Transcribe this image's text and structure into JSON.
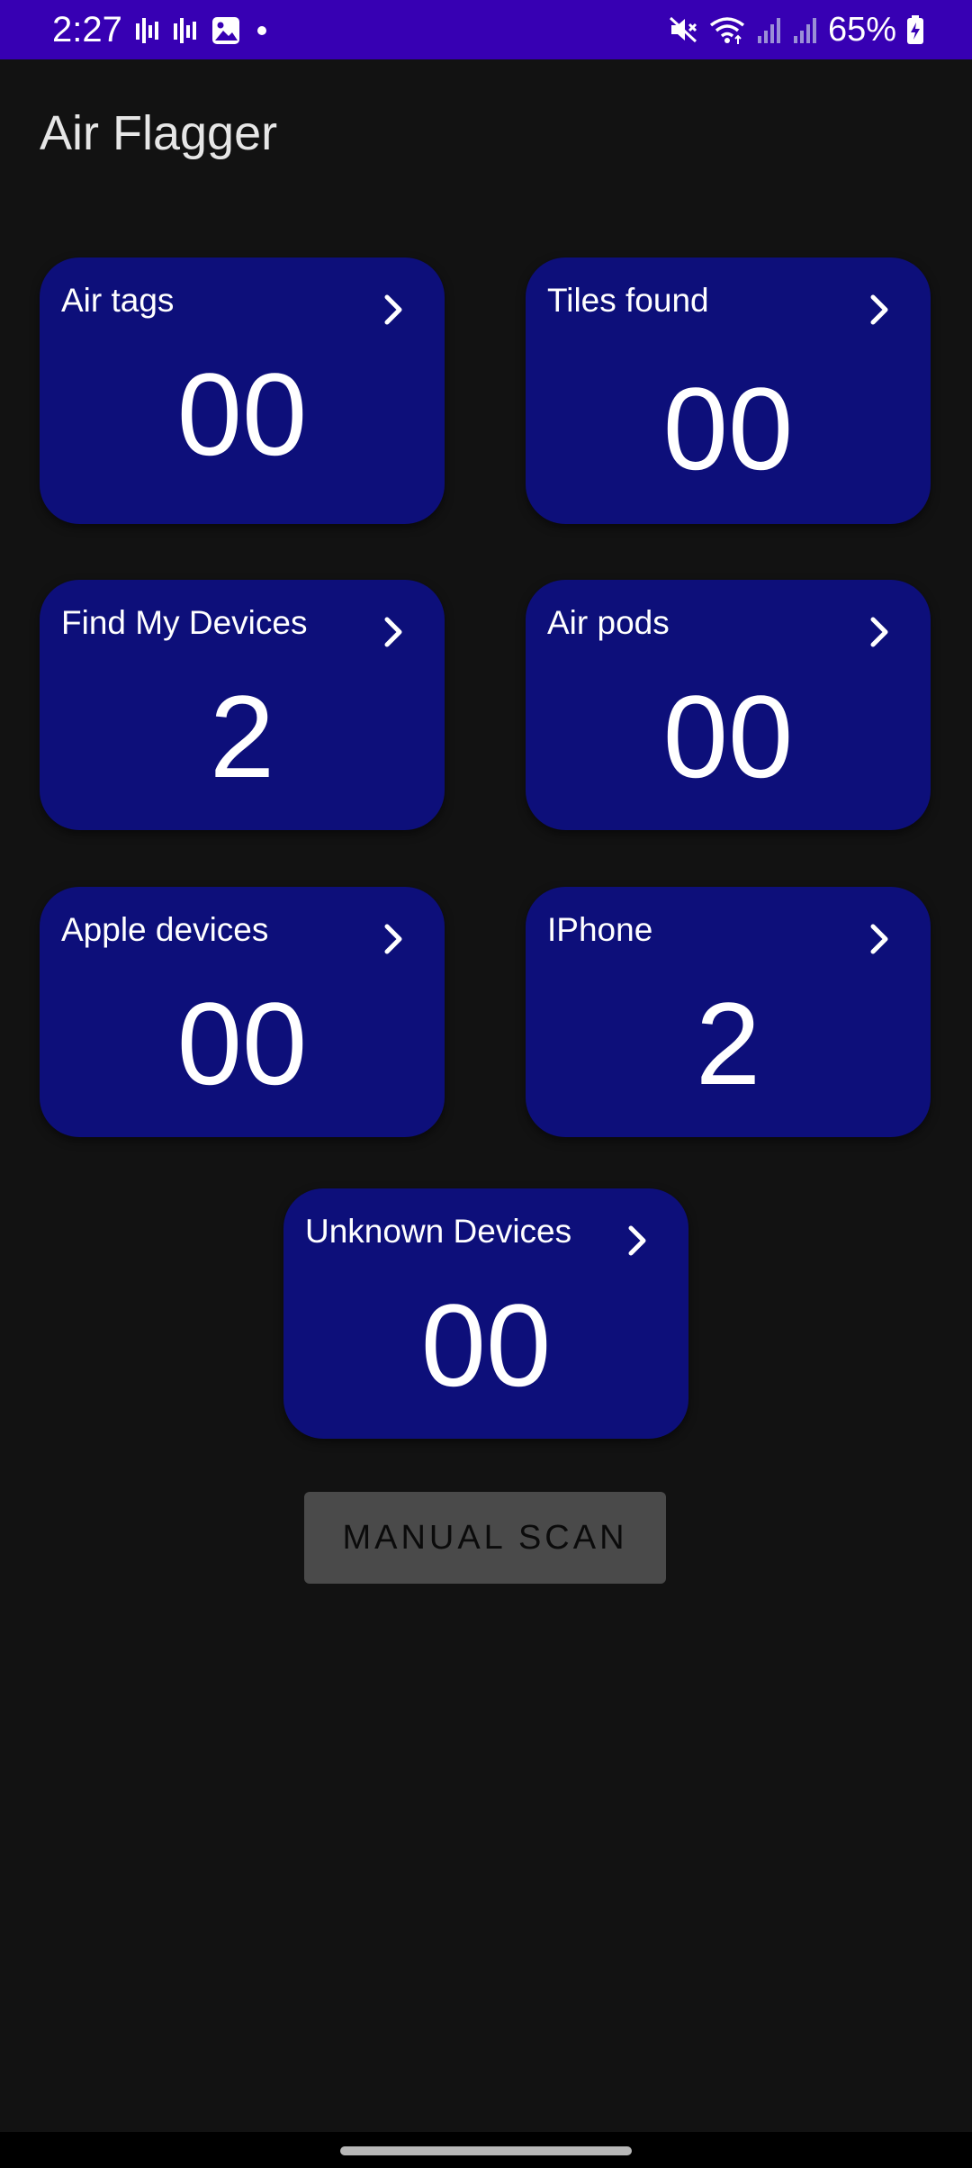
{
  "status_bar": {
    "time": "2:27",
    "battery": "65%",
    "background_color": "#3700b3",
    "left_icons": [
      "signal-bars-icon",
      "signal-bars-icon",
      "gallery-icon",
      "dot-icon"
    ],
    "right_icons": [
      "mute-icon",
      "wifi-icon",
      "cell-signal-icon",
      "cell-signal-icon",
      "battery-charging-icon"
    ]
  },
  "app": {
    "title": "Air Flagger"
  },
  "cards": [
    {
      "label": "Air tags",
      "value": "00"
    },
    {
      "label": "Tiles found",
      "value": "00"
    },
    {
      "label": "Find My Devices",
      "value": "2"
    },
    {
      "label": "Air pods",
      "value": "00"
    },
    {
      "label": "Apple devices",
      "value": "00"
    },
    {
      "label": "IPhone",
      "value": "2"
    },
    {
      "label": "Unknown Devices",
      "value": "00"
    }
  ],
  "card_color": "#0d0f7a",
  "actions": {
    "manual_scan_label": "MANUAL SCAN"
  }
}
